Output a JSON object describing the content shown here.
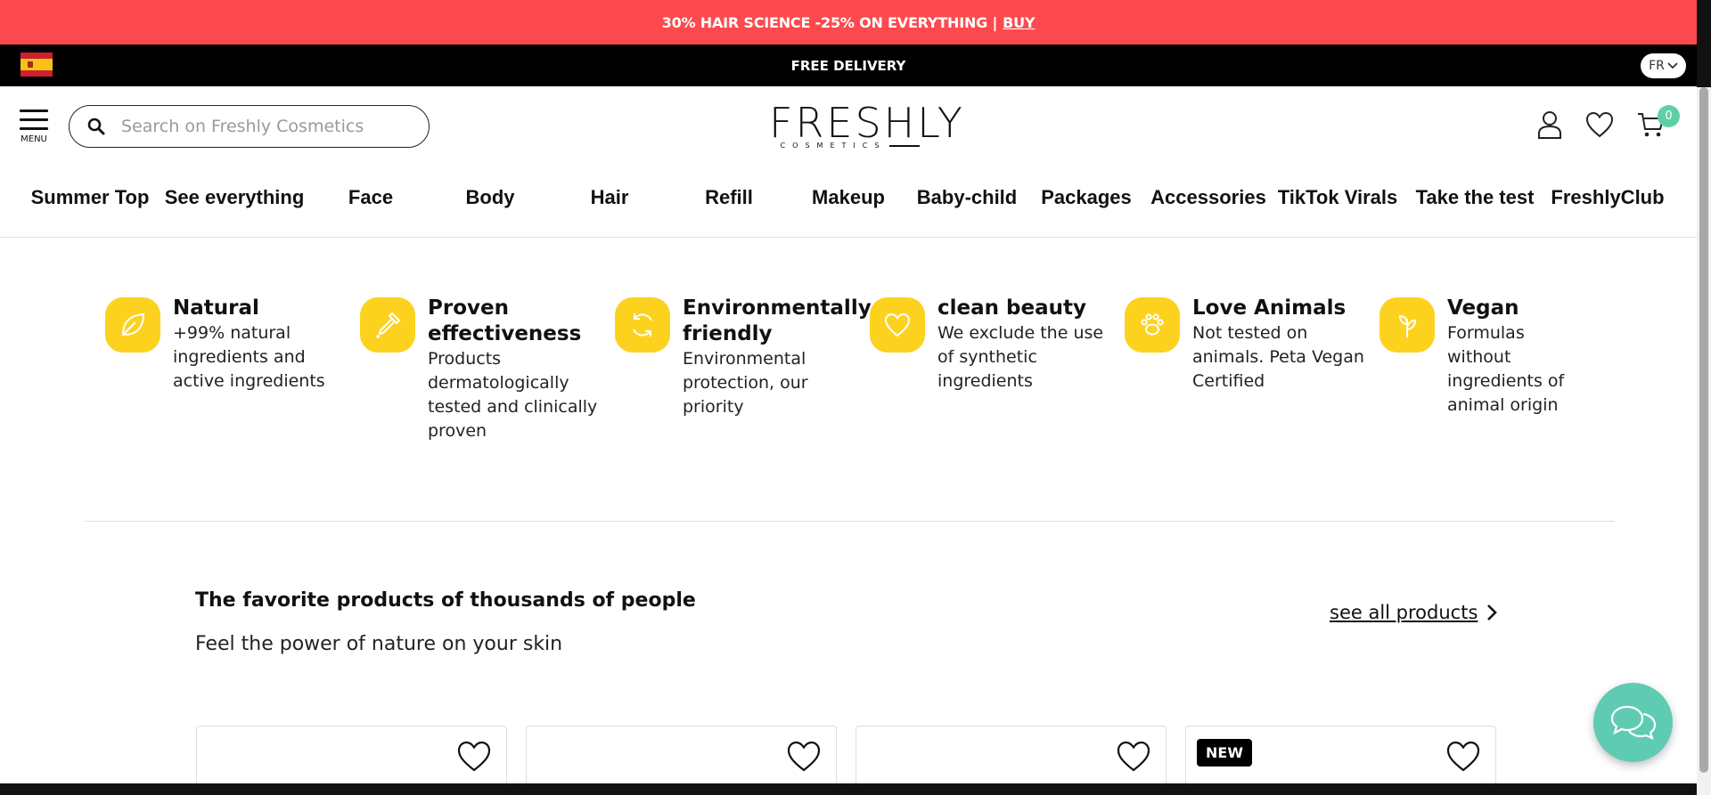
{
  "promo": {
    "text": "30% HAIR SCIENCE -25% ON EVERYTHING |",
    "link": "BUY"
  },
  "delivery": {
    "text": "FREE DELIVERY",
    "language": "FR"
  },
  "header": {
    "menu_label": "MENU",
    "search_placeholder": "Search on Freshly Cosmetics",
    "logo_word": "FRESHLY",
    "logo_sub": "COSMETICS",
    "cart_count": "0"
  },
  "nav": {
    "items": [
      "Summer Top",
      "See everything",
      "Face",
      "Body",
      "Hair",
      "Refill",
      "Makeup",
      "Baby-child",
      "Packages",
      "Accessories",
      "TikTok Virals",
      "Take the test",
      "FreshlyClub"
    ]
  },
  "features": [
    {
      "icon": "leaf-icon",
      "title": "Natural",
      "desc": "+99% natural ingredients and active ingredients"
    },
    {
      "icon": "dropper-icon",
      "title": "Proven effectiveness",
      "desc": "Products dermatologically tested and clinically proven"
    },
    {
      "icon": "recycle-icon",
      "title": "Environmentally friendly",
      "desc": "Environmental protection, our priority"
    },
    {
      "icon": "heart-icon",
      "title": "clean beauty",
      "desc": "We exclude the use of synthetic ingredients"
    },
    {
      "icon": "paw-icon",
      "title": "Love Animals",
      "desc": "Not tested on animals. Peta Vegan Certified"
    },
    {
      "icon": "sprout-icon",
      "title": "Vegan",
      "desc": "Formulas without ingredients of animal origin"
    }
  ],
  "products_section": {
    "title": "The favorite products of thousands of people",
    "subtitle": "Feel the power of nature on your skin",
    "see_all": "see all products",
    "cards": [
      {
        "badge": ""
      },
      {
        "badge": ""
      },
      {
        "badge": ""
      },
      {
        "badge": "NEW"
      }
    ]
  },
  "colors": {
    "promo": "#fc4a4e",
    "accent_yellow": "#fcd21f",
    "chat": "#5fcbb2",
    "cart_badge": "#5ed0a4"
  }
}
